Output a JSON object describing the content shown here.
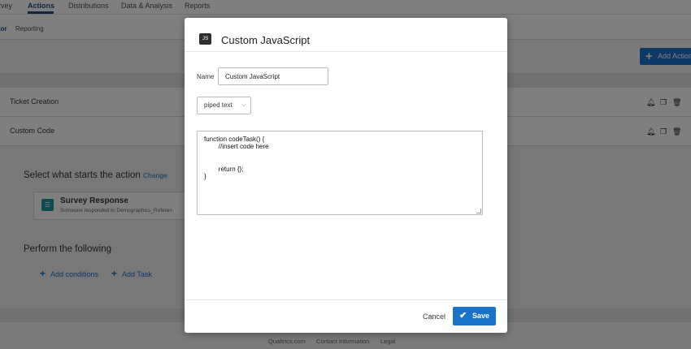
{
  "topnav": {
    "items": [
      "rvey",
      "Actions",
      "Distributions",
      "Data & Analysis",
      "Reports"
    ],
    "active": "Actions"
  },
  "subnav": {
    "items": [
      "tor",
      "Reporting"
    ]
  },
  "toolbar": {
    "add_action_label": "Add Action"
  },
  "actions": {
    "rows": [
      {
        "title": "Ticket Creation"
      },
      {
        "title": "Custom Code"
      }
    ]
  },
  "panel": {
    "starts_heading": "Select what starts the action",
    "change_label": "Change",
    "trigger_title": "Survey Response",
    "trigger_subtitle": "Someone responded to Demographics_Referen",
    "perform_heading": "Perform the following",
    "add_conditions_label": "Add conditions",
    "add_task_label": "Add Task"
  },
  "footer": {
    "links": [
      "Qualtrics.com",
      "Contact Information",
      "Legal"
    ]
  },
  "modal": {
    "badge": "JS",
    "title": "Custom JavaScript",
    "name_label": "Name",
    "name_value": "Custom JavaScript",
    "piped_text_label": "piped text",
    "code_lines": [
      "function codeTask() {",
      "        //insert code here",
      "",
      "",
      "        return {};",
      "}"
    ],
    "cancel_label": "Cancel",
    "save_label": "Save"
  },
  "colors": {
    "accent": "#1a73c9",
    "nav_active": "#1d4e89",
    "overlay": "rgba(0,0,0,0.5)"
  },
  "icons": [
    "plus-icon",
    "bell-icon",
    "copy-icon",
    "trash-icon",
    "clipboard-icon",
    "chevron-down-icon",
    "check-icon",
    "resize-grip-icon"
  ]
}
